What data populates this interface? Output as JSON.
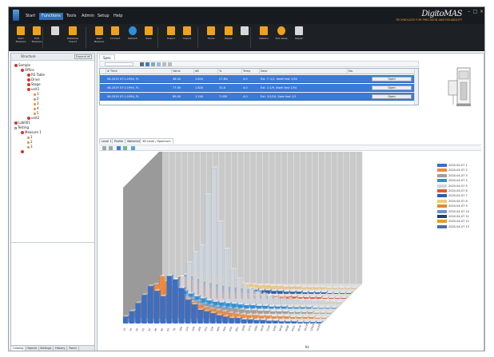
{
  "menubar": {
    "items": [
      "Start",
      "Functions",
      "Tools",
      "Admin",
      "Setup",
      "Help"
    ],
    "active_index": 1,
    "brand": "DigitoMAS",
    "brand_tag": "TECHNOLOGY FOR PRECISION AND RELIABILITY"
  },
  "ribbon": {
    "buttons": [
      {
        "label": "Start Measure",
        "icon": "hand-tool-icon"
      },
      {
        "label": "Edit Measure",
        "icon": "pencil-icon"
      },
      {
        "label": "",
        "icon": "gear-icon"
      },
      {
        "label": "Database Import",
        "icon": "document-stack-icon"
      },
      {
        "label": "Start Measure",
        "icon": "list-icon"
      },
      {
        "label": "Connect",
        "icon": "connect-icon"
      },
      {
        "label": "Refresh",
        "icon": "refresh-icon"
      },
      {
        "label": "Save",
        "icon": "disk-icon"
      },
      {
        "label": "Export",
        "icon": "export-icon"
      },
      {
        "label": "Import",
        "icon": "import-icon"
      },
      {
        "label": "Home",
        "icon": "home-icon"
      },
      {
        "label": "Repair",
        "icon": "wrench-icon"
      },
      {
        "label": "",
        "icon": "lock-icon"
      },
      {
        "label": "Options",
        "icon": "magnifier-icon"
      },
      {
        "label": "Tool setup",
        "icon": "cross-tools-icon"
      },
      {
        "label": "Repair",
        "icon": "spanner-icon"
      }
    ]
  },
  "left_panel": {
    "header": "Structure",
    "button": "Expand all",
    "tree": [
      {
        "label": "Sample",
        "level": 0,
        "kind": "dot"
      },
      {
        "label": "Office",
        "level": 1,
        "kind": "dot"
      },
      {
        "label": "RS Table",
        "level": 2,
        "kind": "dot"
      },
      {
        "label": "Drive",
        "level": 2,
        "kind": "dot"
      },
      {
        "label": "Stage",
        "level": 2,
        "kind": "dot"
      },
      {
        "label": "unit1",
        "level": 2,
        "kind": "dot"
      },
      {
        "label": "1",
        "level": 3,
        "kind": "small"
      },
      {
        "label": "2",
        "level": 3,
        "kind": "small"
      },
      {
        "label": "3",
        "level": 3,
        "kind": "small"
      },
      {
        "label": "4",
        "level": 3,
        "kind": "small"
      },
      {
        "label": "5",
        "level": 3,
        "kind": "small"
      },
      {
        "label": "unit2",
        "level": 2,
        "kind": "dot"
      },
      {
        "label": "Lab001",
        "level": 0,
        "kind": "dot"
      },
      {
        "label": "Testing",
        "level": 0,
        "kind": "box"
      },
      {
        "label": "Measure 1",
        "level": 1,
        "kind": "dot"
      },
      {
        "label": "1",
        "level": 2,
        "kind": "small"
      },
      {
        "label": "2",
        "level": 2,
        "kind": "small"
      },
      {
        "label": "3",
        "level": 2,
        "kind": "small"
      },
      {
        "label": "",
        "level": 1,
        "kind": "dot"
      }
    ],
    "tabs": [
      "Catalog",
      "Objects",
      "Settings",
      "History",
      "Trend"
    ]
  },
  "main": {
    "doc_tab": "Spec",
    "grid": {
      "columns": [
        "# Time",
        "Value",
        "dB",
        "%",
        "Temp",
        "Desc",
        "No."
      ],
      "rows": [
        {
          "time": "06-2019 07:1:1994, FL",
          "value": "48.04",
          "db": "1.820",
          "pct": "27.8%",
          "temp": "4.0",
          "desc": "Ext. T: 1/1, dwell test 1/54",
          "action": "Open"
        },
        {
          "time": "06-2019 07:1:1994, FL",
          "value": "77.00",
          "db": "1.820",
          "pct": "31.8",
          "temp": "4.0",
          "desc": "Ext. 1:1/9, dwell test 1/54",
          "action": "Open"
        },
        {
          "time": "06-2019 07:1:1994, FL",
          "value": "89.00",
          "db": "1.240",
          "pct": "7.000",
          "temp": "4.0",
          "desc": "Ext. 1/1/24, Spec test 1/1",
          "action": "Open"
        }
      ]
    },
    "chart_tabs": [
      "Level 1",
      "Profile",
      "Waterfall",
      "3D Level / Spectrum"
    ],
    "chart_active_tab": 3,
    "chart_bottom_label": "Hz"
  },
  "chart_data": {
    "type": "bar",
    "title": "",
    "xlabel": "Hz",
    "ylabel": "",
    "legend_placement": "right",
    "series": [
      {
        "name": "2020-04-07 1",
        "color": "#3b6fc4"
      },
      {
        "name": "2020-04-07 2",
        "color": "#f08a3c"
      },
      {
        "name": "2020-04-07 3",
        "color": "#9e9e9e"
      },
      {
        "name": "2020-04-07 4",
        "color": "#2f8fd8"
      },
      {
        "name": "2020-04-07 5",
        "color": "#cfd5dc"
      },
      {
        "name": "2020-04-07 6",
        "color": "#e2572b"
      },
      {
        "name": "2020-04-07 7",
        "color": "#2b5fa8"
      },
      {
        "name": "2020-04-07 8",
        "color": "#f5c87a"
      },
      {
        "name": "2020-04-07 9",
        "color": "#d98b3a"
      },
      {
        "name": "2020-04-07 10",
        "color": "#6f90c6"
      },
      {
        "name": "2020-04-07 11",
        "color": "#223f72"
      },
      {
        "name": "2020-04-07 12",
        "color": "#e89a2a"
      },
      {
        "name": "2020-04-07 13",
        "color": "#4a6fa5"
      }
    ],
    "category_count": 32,
    "profiles": [
      [
        10,
        18,
        30,
        42,
        55,
        48,
        40,
        70,
        65,
        52,
        35,
        28,
        20,
        18,
        15,
        12,
        10,
        8,
        8,
        6,
        6,
        5,
        5,
        4,
        4,
        3,
        3,
        3,
        2,
        2,
        2,
        2
      ],
      [
        6,
        12,
        22,
        36,
        50,
        62,
        55,
        45,
        38,
        30,
        24,
        20,
        16,
        14,
        12,
        10,
        8,
        7,
        6,
        5,
        5,
        4,
        4,
        3,
        3,
        3,
        2,
        2,
        2,
        2,
        1,
        1
      ],
      [
        4,
        9,
        15,
        25,
        35,
        45,
        38,
        30,
        26,
        22,
        18,
        14,
        12,
        10,
        9,
        8,
        7,
        6,
        5,
        5,
        4,
        4,
        3,
        3,
        3,
        2,
        2,
        2,
        2,
        1,
        1,
        1
      ],
      [
        3,
        6,
        12,
        20,
        28,
        34,
        30,
        26,
        22,
        18,
        15,
        12,
        10,
        9,
        8,
        7,
        6,
        5,
        5,
        4,
        4,
        3,
        3,
        3,
        2,
        2,
        2,
        2,
        1,
        1,
        1,
        1
      ],
      [
        8,
        14,
        20,
        25,
        30,
        35,
        40,
        60,
        75,
        85,
        160,
        200,
        120,
        80,
        50,
        36,
        28,
        22,
        18,
        14,
        12,
        10,
        8,
        7,
        6,
        5,
        5,
        4,
        4,
        3,
        3,
        2
      ],
      [
        5,
        10,
        16,
        22,
        28,
        32,
        30,
        26,
        22,
        18,
        15,
        12,
        10,
        9,
        8,
        7,
        6,
        5,
        5,
        4,
        4,
        3,
        3,
        3,
        2,
        2,
        2,
        2,
        1,
        1,
        1,
        1
      ],
      [
        4,
        8,
        12,
        18,
        24,
        28,
        26,
        22,
        18,
        16,
        14,
        12,
        10,
        9,
        8,
        7,
        6,
        5,
        5,
        4,
        4,
        3,
        3,
        3,
        2,
        2,
        2,
        2,
        1,
        1,
        1,
        1
      ],
      [
        3,
        6,
        10,
        14,
        20,
        24,
        22,
        18,
        16,
        14,
        12,
        10,
        9,
        8,
        7,
        6,
        5,
        5,
        4,
        4,
        3,
        3,
        3,
        2,
        2,
        2,
        2,
        1,
        1,
        1,
        1,
        1
      ]
    ]
  }
}
